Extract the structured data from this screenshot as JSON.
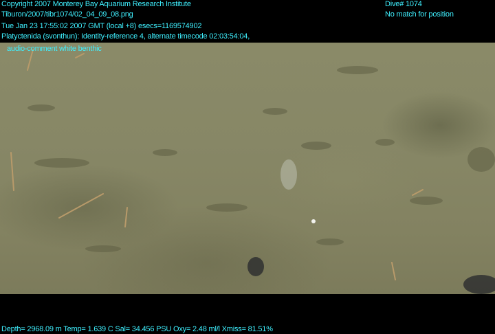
{
  "overlay": {
    "copyright": "Copyright 2007 Monterey Bay Aquarium Research Institute",
    "image_path": "Tiburon/2007/tibr1074/02_04_09_08.png",
    "timestamp": "Tue Jan 23 17:55:02 2007 GMT (local +8)  esecs=1169574902",
    "annotation": "Platyctenida (svonthun): Identity-reference 4, alternate timecode 02:03:54:04,",
    "comment": "audio-comment white benthic",
    "dive": "Dive# 1074",
    "position": "No match for position",
    "telemetry": "Depth= 2968.09 m  Temp= 1.639 C  Sal= 34.456 PSU  Oxy= 2.48 ml/l  Xmiss= 81.51%"
  },
  "colors": {
    "overlay_text": "#3ff0ff",
    "letterbox": "#000000",
    "sediment": "#878766"
  }
}
